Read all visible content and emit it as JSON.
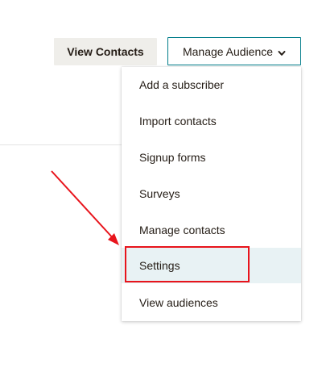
{
  "header": {
    "view_contacts_label": "View Contacts",
    "manage_audience_label": "Manage Audience"
  },
  "menu": {
    "items": [
      {
        "label": "Add a subscriber"
      },
      {
        "label": "Import contacts"
      },
      {
        "label": "Signup forms"
      },
      {
        "label": "Surveys"
      },
      {
        "label": "Manage contacts"
      },
      {
        "label": "Settings",
        "highlighted": true
      },
      {
        "label": "View audiences"
      }
    ]
  },
  "icons": {
    "dropdown": "chevron-down-icon",
    "annotation_arrow": "arrow-icon"
  },
  "colors": {
    "accent_border": "#007c89",
    "highlight_bg": "#e8f2f4",
    "annotation_red": "#e8141c",
    "secondary_button_bg": "#efeeea",
    "text": "#241c15"
  }
}
